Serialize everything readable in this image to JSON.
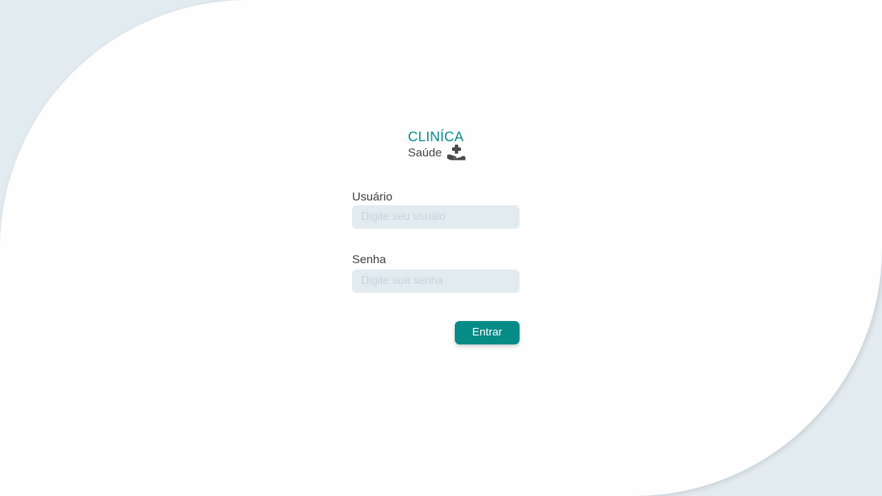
{
  "brand": {
    "title": "CLINÍCA",
    "subtitle": "Saúde",
    "icon": "hand-holding-medical-icon",
    "accent_color": "#078b86"
  },
  "form": {
    "username": {
      "label": "Usuário",
      "placeholder": "Digite seu usuáio",
      "value": ""
    },
    "password": {
      "label": "Senha",
      "placeholder": "Digite sua senha",
      "value": ""
    },
    "submit_label": "Entrar"
  }
}
